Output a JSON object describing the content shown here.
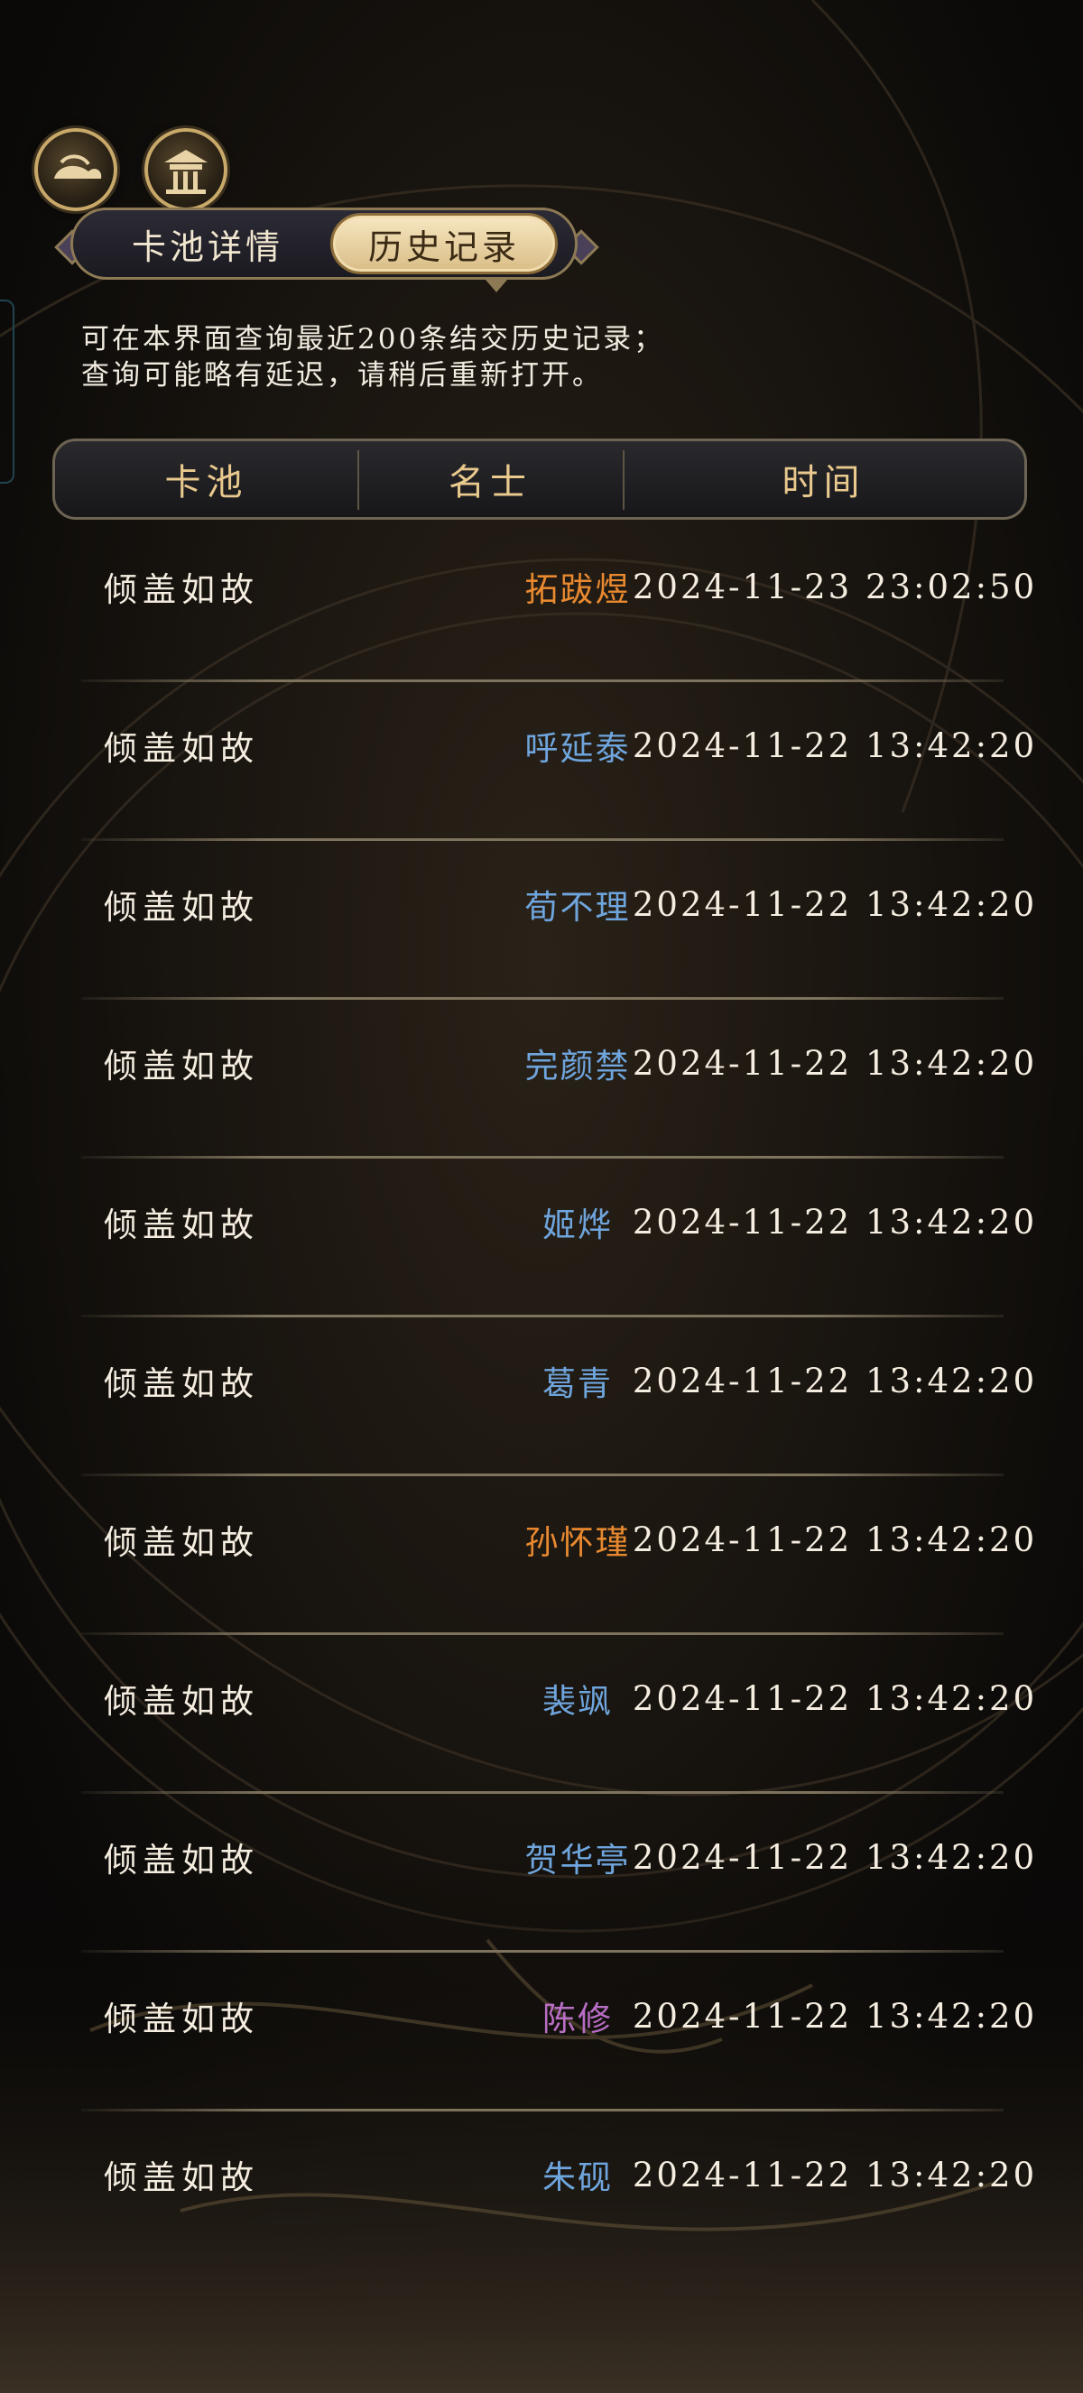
{
  "top_icons": [
    {
      "name": "cloud-emblem-icon"
    },
    {
      "name": "pavilion-emblem-icon"
    }
  ],
  "tabs": {
    "details_label": "卡池详情",
    "history_label": "历史记录",
    "active": "history"
  },
  "notice": {
    "line1": "可在本界面查询最近200条结交历史记录；",
    "line2": "查询可能略有延迟，请稍后重新打开。"
  },
  "table": {
    "headers": {
      "pool": "卡池",
      "name": "名士",
      "time": "时间"
    },
    "rows": [
      {
        "pool": "倾盖如故",
        "name": "拓跋煜",
        "time": "2024-11-23 23:02:50",
        "color": "#e8892f"
      },
      {
        "pool": "倾盖如故",
        "name": "呼延泰",
        "time": "2024-11-22 13:42:20",
        "color": "#6fa5dd"
      },
      {
        "pool": "倾盖如故",
        "name": "荀不理",
        "time": "2024-11-22 13:42:20",
        "color": "#6fa5dd"
      },
      {
        "pool": "倾盖如故",
        "name": "完颜禁",
        "time": "2024-11-22 13:42:20",
        "color": "#6fa5dd"
      },
      {
        "pool": "倾盖如故",
        "name": "姬烨",
        "time": "2024-11-22 13:42:20",
        "color": "#6fa5dd"
      },
      {
        "pool": "倾盖如故",
        "name": "葛青",
        "time": "2024-11-22 13:42:20",
        "color": "#6fa5dd"
      },
      {
        "pool": "倾盖如故",
        "name": "孙怀瑾",
        "time": "2024-11-22 13:42:20",
        "color": "#e8892f"
      },
      {
        "pool": "倾盖如故",
        "name": "裴飒",
        "time": "2024-11-22 13:42:20",
        "color": "#6fa5dd"
      },
      {
        "pool": "倾盖如故",
        "name": "贺华亭",
        "time": "2024-11-22 13:42:20",
        "color": "#6fa5dd"
      },
      {
        "pool": "倾盖如故",
        "name": "陈修",
        "time": "2024-11-22 13:42:20",
        "color": "#b86ec4"
      },
      {
        "pool": "倾盖如故",
        "name": "朱砚",
        "time": "2024-11-22 13:42:20",
        "color": "#6fa5dd"
      }
    ]
  }
}
